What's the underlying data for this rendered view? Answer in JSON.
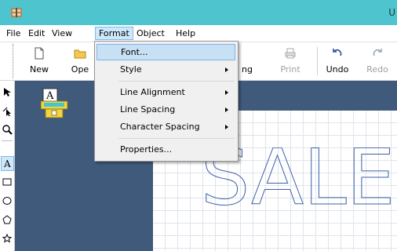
{
  "window": {
    "title_fragment": "U"
  },
  "menubar": {
    "file": "File",
    "edit": "Edit",
    "view": "View",
    "format": "Format",
    "object": "Object",
    "help": "Help"
  },
  "toolbar": {
    "new": "New",
    "open": "Ope",
    "page_setup": "ng",
    "print": "Print",
    "undo": "Undo",
    "redo": "Redo"
  },
  "format_menu": {
    "font": "Font...",
    "style": "Style",
    "line_alignment": "Line Alignment",
    "line_spacing": "Line Spacing",
    "character_spacing": "Character Spacing",
    "properties": "Properties..."
  },
  "canvas": {
    "text": "SALE"
  },
  "colors": {
    "titlebar": "#4ec4cf",
    "workspace": "#3f5a7a",
    "menu_highlight": "#c7e0f4",
    "outline_text": "#3d5fa8"
  }
}
